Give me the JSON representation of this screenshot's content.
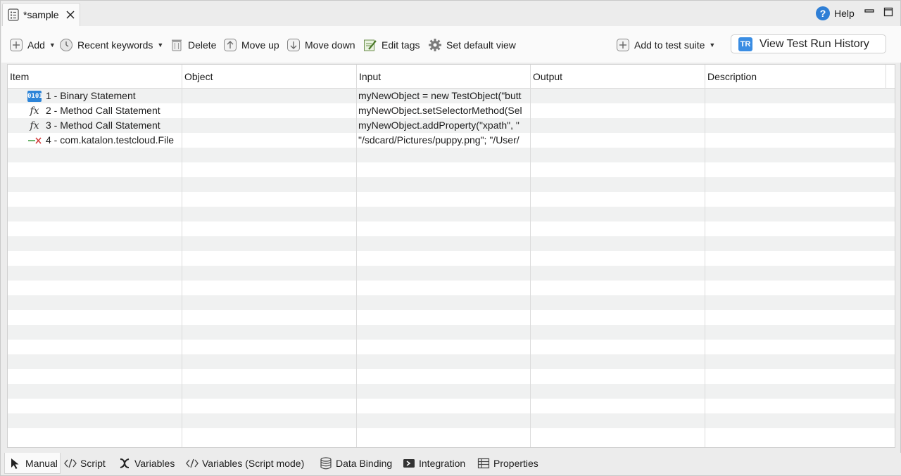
{
  "editor_tab": {
    "title": "*sample"
  },
  "help": {
    "label": "Help"
  },
  "toolbar": {
    "add": "Add",
    "recent_keywords": "Recent keywords",
    "delete": "Delete",
    "move_up": "Move up",
    "move_down": "Move down",
    "edit_tags": "Edit tags",
    "set_default_view": "Set default view",
    "add_to_test_suite": "Add to test suite",
    "view_test_run_history": "View Test Run History",
    "view_history_badge": "TR"
  },
  "table": {
    "columns": [
      "Item",
      "Object",
      "Input",
      "Output",
      "Description"
    ],
    "rows": [
      {
        "icon": "binary-statement-icon",
        "icon_text": "0101",
        "item": "1 - Binary Statement",
        "object": "",
        "input": "myNewObject = new TestObject(\"butt",
        "output": "",
        "description": ""
      },
      {
        "icon": "method-call-icon",
        "icon_text": "fx",
        "item": "2 - Method Call Statement",
        "object": "",
        "input": "myNewObject.setSelectorMethod(Sel",
        "output": "",
        "description": ""
      },
      {
        "icon": "method-call-icon",
        "icon_text": "fx",
        "item": "3 - Method Call Statement",
        "object": "",
        "input": "myNewObject.addProperty(\"xpath\", \"",
        "output": "",
        "description": ""
      },
      {
        "icon": "keyword-icon",
        "icon_text": "",
        "item": "4 - com.katalon.testcloud.File",
        "object": "",
        "input": "\"/sdcard/Pictures/puppy.png\"; \"/User/",
        "output": "",
        "description": ""
      }
    ],
    "empty_rows": 20
  },
  "bottom_tabs": [
    {
      "label": "Manual",
      "icon": "cursor-icon",
      "active": true
    },
    {
      "label": "Script",
      "icon": "code-icon",
      "active": false
    },
    {
      "label": "Variables",
      "icon": "variable-x-icon",
      "active": false
    },
    {
      "label": "Variables (Script mode)",
      "icon": "code-icon",
      "active": false
    },
    {
      "label": "Data Binding",
      "icon": "database-icon",
      "active": false
    },
    {
      "label": "Integration",
      "icon": "integration-icon",
      "active": false
    },
    {
      "label": "Properties",
      "icon": "table-icon",
      "active": false
    }
  ]
}
